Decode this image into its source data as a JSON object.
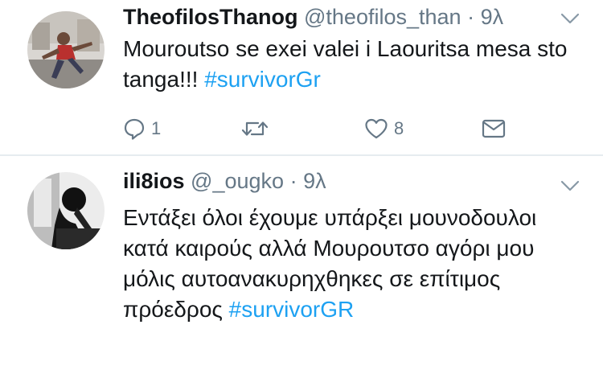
{
  "tweets": [
    {
      "display_name": "TheofilosThanog",
      "handle": "@theofilos_than",
      "dot": "·",
      "time": "9λ",
      "text_before": "Mouroutso se exei valei i Laouritsa mesa sto tanga!!! ",
      "hashtag": "#survivorGr",
      "reply_count": "1",
      "retweet_count": "",
      "like_count": "8"
    },
    {
      "display_name": "ili8ios",
      "handle": "@_ougko",
      "dot": "·",
      "time": "9λ",
      "text_before": "Εντάξει όλοι έχουμε υπάρξει μουνοδουλοι κατά καιρούς αλλά Μουρουτσο αγόρι μου μόλις αυτοανακυρηχθηκες σε επίτιμος πρόεδρος ",
      "hashtag": "#survivorGR"
    }
  ],
  "colors": {
    "text": "#14171a",
    "secondary": "#657786",
    "link": "#1da1f2",
    "divider": "#e6ecf0"
  },
  "icons": {
    "reply": "reply-icon",
    "retweet": "retweet-icon",
    "like": "heart-icon",
    "dm": "envelope-icon",
    "caret": "chevron-down-icon"
  }
}
